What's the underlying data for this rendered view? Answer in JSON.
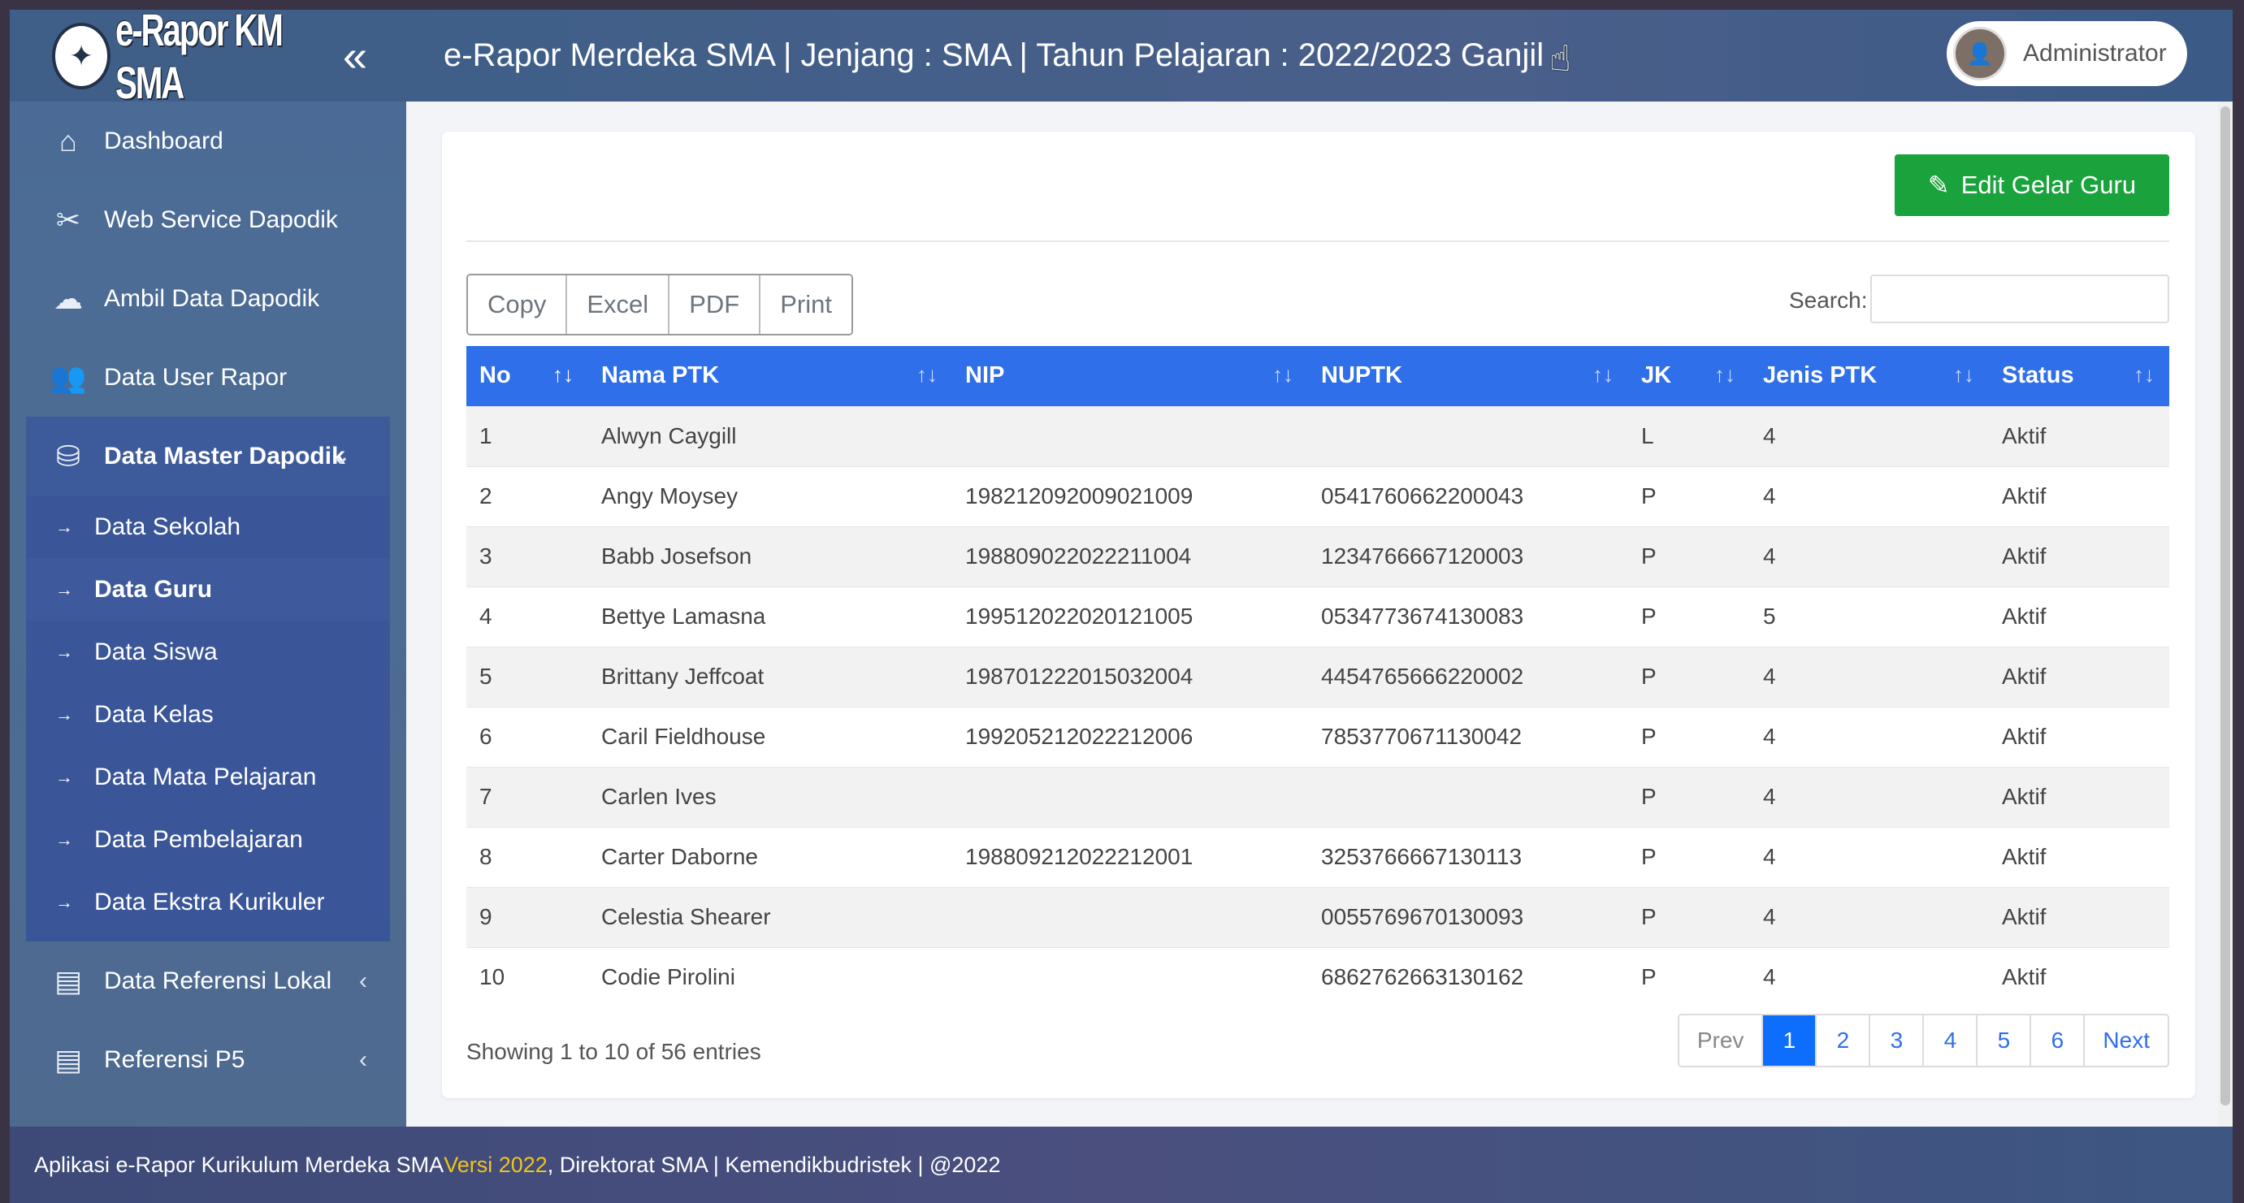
{
  "brand": {
    "name": "e-Rapor KM SMA",
    "collapse_icon": "double-chevron-left-icon"
  },
  "header": {
    "title": "e-Rapor Merdeka SMA | Jenjang : SMA | Tahun Pelajaran : 2022/2023 Ganjil",
    "user": "Administrator"
  },
  "sidebar": {
    "items": [
      {
        "label": "Dashboard",
        "icon": "home-icon"
      },
      {
        "label": "Web Service Dapodik",
        "icon": "tools-icon"
      },
      {
        "label": "Ambil Data Dapodik",
        "icon": "cloud-download-icon"
      },
      {
        "label": "Data User Rapor",
        "icon": "users-icon"
      },
      {
        "label": "Data Master Dapodik",
        "icon": "database-icon"
      }
    ],
    "submenu": [
      {
        "label": "Data Sekolah"
      },
      {
        "label": "Data Guru"
      },
      {
        "label": "Data Siswa"
      },
      {
        "label": "Data Kelas"
      },
      {
        "label": "Data Mata Pelajaran"
      },
      {
        "label": "Data Pembelajaran"
      },
      {
        "label": "Data Ekstra Kurikuler"
      }
    ],
    "bottom": [
      {
        "label": "Data Referensi Lokal",
        "icon": "inbox-icon"
      },
      {
        "label": "Referensi P5",
        "icon": "inbox-icon"
      }
    ]
  },
  "toolbar": {
    "edit_button": "Edit Gelar Guru",
    "export": [
      "Copy",
      "Excel",
      "PDF",
      "Print"
    ],
    "search_label": "Search:",
    "search_value": ""
  },
  "table": {
    "columns": [
      "No",
      "Nama PTK",
      "NIP",
      "NUPTK",
      "JK",
      "Jenis PTK",
      "Status"
    ],
    "rows": [
      [
        "1",
        "Alwyn Caygill",
        "",
        "",
        "L",
        "4",
        "Aktif"
      ],
      [
        "2",
        "Angy Moysey",
        "198212092009021009",
        "0541760662200043",
        "P",
        "4",
        "Aktif"
      ],
      [
        "3",
        "Babb Josefson",
        "198809022022211004",
        "1234766667120003",
        "P",
        "4",
        "Aktif"
      ],
      [
        "4",
        "Bettye Lamasna",
        "199512022020121005",
        "0534773674130083",
        "P",
        "5",
        "Aktif"
      ],
      [
        "5",
        "Brittany Jeffcoat",
        "198701222015032004",
        "4454765666220002",
        "P",
        "4",
        "Aktif"
      ],
      [
        "6",
        "Caril Fieldhouse",
        "199205212022212006",
        "7853770671130042",
        "P",
        "4",
        "Aktif"
      ],
      [
        "7",
        "Carlen Ives",
        "",
        "",
        "P",
        "4",
        "Aktif"
      ],
      [
        "8",
        "Carter Daborne",
        "198809212022212001",
        "3253766667130113",
        "P",
        "4",
        "Aktif"
      ],
      [
        "9",
        "Celestia Shearer",
        "",
        "0055769670130093",
        "P",
        "4",
        "Aktif"
      ],
      [
        "10",
        "Codie Pirolini",
        "",
        "6862762663130162",
        "P",
        "4",
        "Aktif"
      ]
    ]
  },
  "pagination": {
    "info": "Showing 1 to 10 of 56 entries",
    "prev": "Prev",
    "pages": [
      "1",
      "2",
      "3",
      "4",
      "5",
      "6"
    ],
    "next": "Next",
    "current": "1"
  },
  "footer": {
    "text_before": "Aplikasi e-Rapor Kurikulum Merdeka SMA ",
    "version": "Versi 2022",
    "text_after": ", Direktorat SMA | Kemendikbudristek | @2022"
  }
}
